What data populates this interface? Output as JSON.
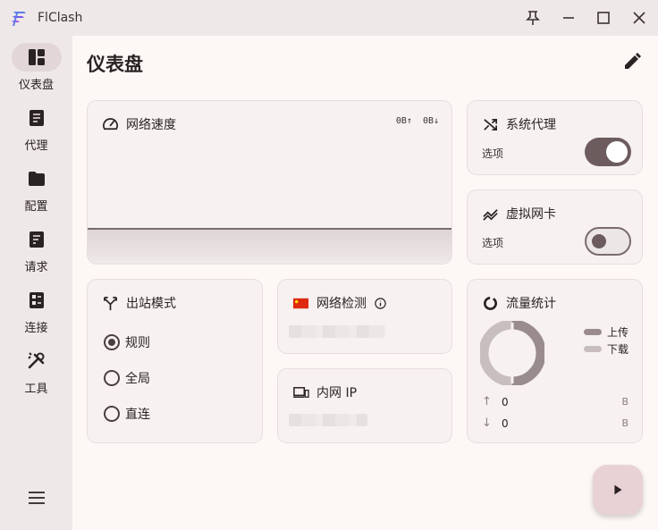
{
  "window": {
    "title": "FlClash",
    "controls": [
      "pin-icon",
      "minimize-icon",
      "maximize-icon",
      "close-icon"
    ]
  },
  "sidebar": {
    "items": [
      {
        "label": "仪表盘",
        "icon": "dashboard-icon",
        "active": true
      },
      {
        "label": "代理",
        "icon": "proxy-icon",
        "active": false
      },
      {
        "label": "配置",
        "icon": "folder-icon",
        "active": false
      },
      {
        "label": "请求",
        "icon": "request-icon",
        "active": false
      },
      {
        "label": "连接",
        "icon": "connection-icon",
        "active": false
      },
      {
        "label": "工具",
        "icon": "tools-icon",
        "active": false
      }
    ],
    "menu_icon": "menu-icon"
  },
  "page": {
    "title": "仪表盘",
    "edit_icon": "edit-icon"
  },
  "network_speed": {
    "title": "网络速度",
    "upload": "0B↑",
    "download": "0B↓"
  },
  "system_proxy": {
    "title": "系统代理",
    "option_label": "选项",
    "enabled": true
  },
  "virtual_nic": {
    "title": "虚拟网卡",
    "option_label": "选项",
    "enabled": false
  },
  "outbound_mode": {
    "title": "出站模式",
    "options": [
      {
        "label": "规则",
        "checked": true
      },
      {
        "label": "全局",
        "checked": false
      },
      {
        "label": "直连",
        "checked": false
      }
    ]
  },
  "network_check": {
    "title": "网络检测",
    "flag_icon": "china-flag-icon",
    "info_icon": "info-icon"
  },
  "intranet_ip": {
    "title": "内网 IP",
    "icon": "devices-icon"
  },
  "traffic_stats": {
    "title": "流量统计",
    "legend": [
      {
        "label": "上传",
        "color": "#9a8c8e"
      },
      {
        "label": "下载",
        "color": "#c9bebf"
      }
    ],
    "rows": [
      {
        "arrow": "↑",
        "value": "0",
        "unit": "B"
      },
      {
        "arrow": "↓",
        "value": "0",
        "unit": "B"
      }
    ]
  },
  "colors": {
    "accent": "#6d5c5e",
    "sidebar_bg": "#efe8e8",
    "card_bg": "#f7f1f1",
    "fab_bg": "#e9d2d5"
  },
  "fab": {
    "icon": "play-icon"
  }
}
